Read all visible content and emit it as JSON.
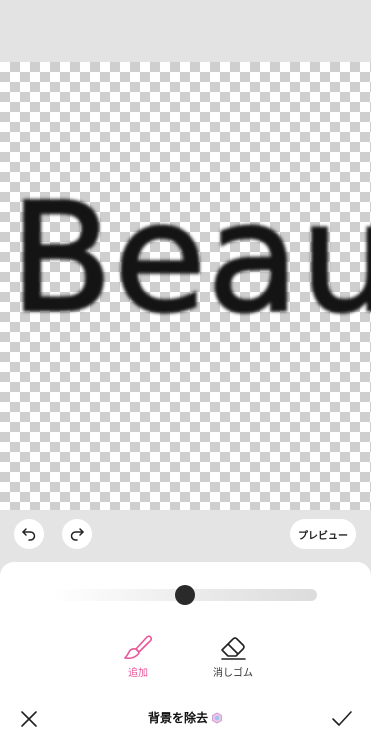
{
  "canvas": {
    "text": "Beau"
  },
  "toolbar": {
    "preview_label": "プレビュー"
  },
  "brush_size_slider": {
    "value_fraction": 0.5
  },
  "tools": {
    "add_label": "追加",
    "erase_label": "消しゴム",
    "active_tool": "add"
  },
  "footer": {
    "title": "背景を除去"
  },
  "colors": {
    "accent": "#e8579a",
    "checker_dark": "#cfcfcf",
    "checker_light": "#ffffff",
    "panel_bg": "#ffffff",
    "background": "#e4e4e4"
  },
  "icons": {
    "undo": "undo-icon",
    "redo": "redo-icon",
    "add_tool": "brush-icon",
    "erase_tool": "eraser-icon",
    "close": "close-icon",
    "confirm": "checkmark-icon",
    "premium": "premium-gem-icon"
  }
}
